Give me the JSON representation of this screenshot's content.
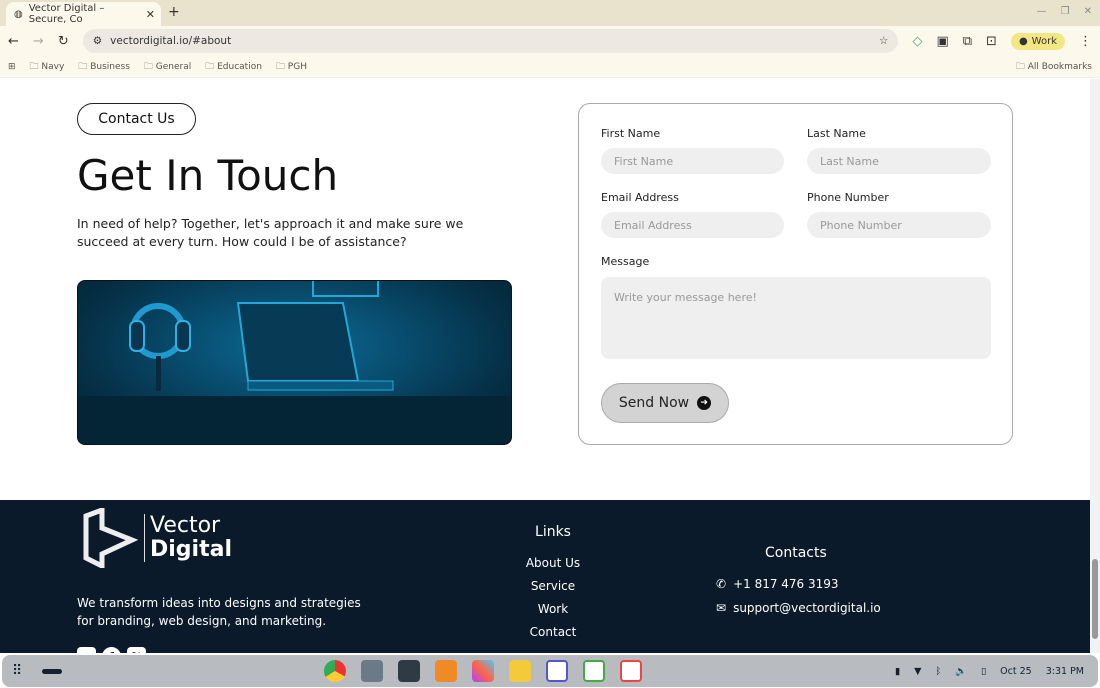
{
  "browser": {
    "tab_title": "Vector Digital – Secure, Co",
    "url": "vectordigital.io/#about",
    "profile": "Work",
    "bookmarks": [
      "Navy",
      "Business",
      "General",
      "Education",
      "PGH"
    ],
    "all_bookmarks": "All Bookmarks"
  },
  "main": {
    "pill": "Contact Us",
    "title": "Get In Touch",
    "intro": "In need of help? Together, let's approach it and make sure we succeed at every turn. How could I be of assistance?"
  },
  "form": {
    "first_label": "First Name",
    "first_ph": "First Name",
    "last_label": "Last Name",
    "last_ph": "Last Name",
    "email_label": "Email Address",
    "email_ph": "Email Address",
    "phone_label": "Phone Number",
    "phone_ph": "Phone Number",
    "message_label": "Message",
    "message_ph": "Write your message here!",
    "send": "Send Now"
  },
  "footer": {
    "logo_line1": "Vector",
    "logo_line2": "Digital",
    "tagline": "We transform ideas into designs and strategies for branding, web design, and marketing.",
    "links_title": "Links",
    "links": [
      "About Us",
      "Service",
      "Work",
      "Contact"
    ],
    "contacts_title": "Contacts",
    "phone": "+1 817 476 3193",
    "email": "support@vectordigital.io"
  },
  "shelf": {
    "date": "Oct 25",
    "time": "3:31 PM"
  }
}
